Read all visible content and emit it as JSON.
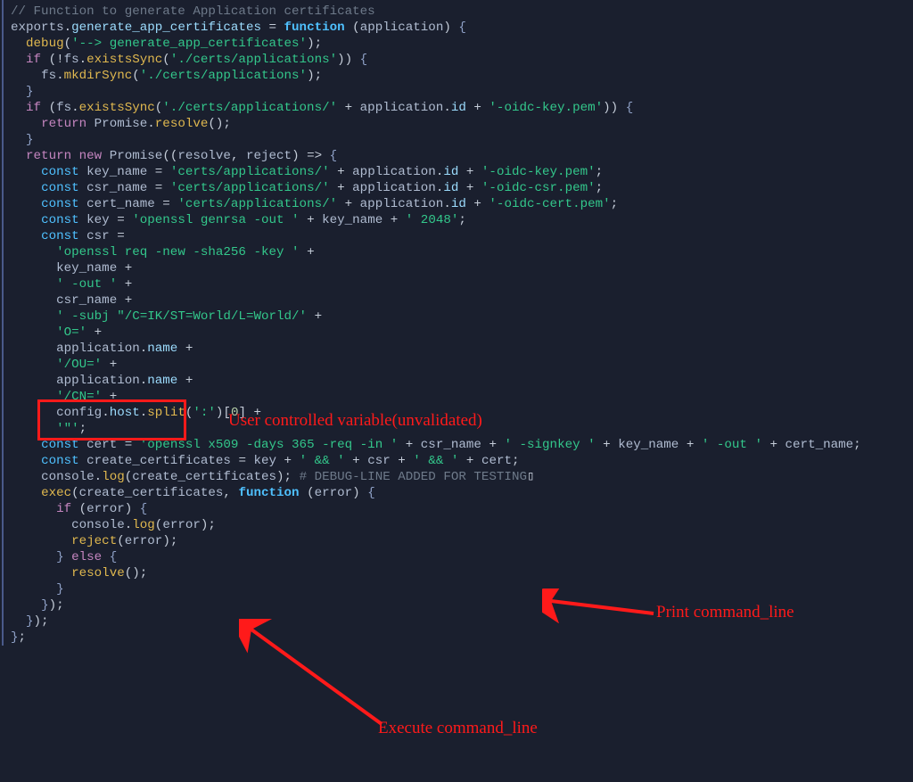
{
  "code_lines_html": [
    "<span class='c-comment'>// Function to generate Application certificates</span>",
    "<span class='c-ident'>exports</span><span class='c-punc'>.</span><span class='c-prop'>generate_app_certificates</span> <span class='c-op'>=</span> <span class='c-func'>function</span> <span class='c-punc'>(</span><span class='c-ident'>application</span><span class='c-punc'>)</span> <span class='c-brace'>{</span>",
    "  <span class='c-call'>debug</span><span class='c-punc'>(</span><span class='c-string'>'--&gt; generate_app_certificates'</span><span class='c-punc'>);</span>",
    "",
    "  <span class='c-keyword2'>if</span> <span class='c-punc'>(</span><span class='c-op'>!</span><span class='c-ident'>fs</span><span class='c-punc'>.</span><span class='c-call'>existsSync</span><span class='c-punc'>(</span><span class='c-string'>'./certs/applications'</span><span class='c-punc'>))</span> <span class='c-brace'>{</span>",
    "    <span class='c-ident'>fs</span><span class='c-punc'>.</span><span class='c-call'>mkdirSync</span><span class='c-punc'>(</span><span class='c-string'>'./certs/applications'</span><span class='c-punc'>);</span>",
    "  <span class='c-brace'>}</span>",
    "",
    "  <span class='c-keyword2'>if</span> <span class='c-punc'>(</span><span class='c-ident'>fs</span><span class='c-punc'>.</span><span class='c-call'>existsSync</span><span class='c-punc'>(</span><span class='c-string'>'./certs/applications/'</span> <span class='c-op'>+</span> <span class='c-ident'>application</span><span class='c-punc'>.</span><span class='c-prop'>id</span> <span class='c-op'>+</span> <span class='c-string'>'-oidc-key.pem'</span><span class='c-punc'>))</span> <span class='c-brace'>{</span>",
    "    <span class='c-keyword2'>return</span> <span class='c-ident'>Promise</span><span class='c-punc'>.</span><span class='c-call'>resolve</span><span class='c-punc'>();</span>",
    "  <span class='c-brace'>}</span>",
    "",
    "  <span class='c-keyword2'>return</span> <span class='c-keyword2'>new</span> <span class='c-ident'>Promise</span><span class='c-punc'>((</span><span class='c-ident'>resolve</span><span class='c-punc'>,</span> <span class='c-ident'>reject</span><span class='c-punc'>)</span> <span class='c-op'>=&gt;</span> <span class='c-brace'>{</span>",
    "    <span class='c-keyword'>const</span> <span class='c-ident'>key_name</span> <span class='c-op'>=</span> <span class='c-string'>'certs/applications/'</span> <span class='c-op'>+</span> <span class='c-ident'>application</span><span class='c-punc'>.</span><span class='c-prop'>id</span> <span class='c-op'>+</span> <span class='c-string'>'-oidc-key.pem'</span><span class='c-punc'>;</span>",
    "    <span class='c-keyword'>const</span> <span class='c-ident'>csr_name</span> <span class='c-op'>=</span> <span class='c-string'>'certs/applications/'</span> <span class='c-op'>+</span> <span class='c-ident'>application</span><span class='c-punc'>.</span><span class='c-prop'>id</span> <span class='c-op'>+</span> <span class='c-string'>'-oidc-csr.pem'</span><span class='c-punc'>;</span>",
    "    <span class='c-keyword'>const</span> <span class='c-ident'>cert_name</span> <span class='c-op'>=</span> <span class='c-string'>'certs/applications/'</span> <span class='c-op'>+</span> <span class='c-ident'>application</span><span class='c-punc'>.</span><span class='c-prop'>id</span> <span class='c-op'>+</span> <span class='c-string'>'-oidc-cert.pem'</span><span class='c-punc'>;</span>",
    "",
    "    <span class='c-keyword'>const</span> <span class='c-ident'>key</span> <span class='c-op'>=</span> <span class='c-string'>'openssl genrsa -out '</span> <span class='c-op'>+</span> <span class='c-ident'>key_name</span> <span class='c-op'>+</span> <span class='c-string'>' 2048'</span><span class='c-punc'>;</span>",
    "    <span class='c-keyword'>const</span> <span class='c-ident'>csr</span> <span class='c-op'>=</span>",
    "      <span class='c-string'>'openssl req -new -sha256 -key '</span> <span class='c-op'>+</span>",
    "      <span class='c-ident'>key_name</span> <span class='c-op'>+</span>",
    "      <span class='c-string'>' -out '</span> <span class='c-op'>+</span>",
    "      <span class='c-ident'>csr_name</span> <span class='c-op'>+</span>",
    "      <span class='c-string'>' -subj \"/C=IK/ST=World/L=World/'</span> <span class='c-op'>+</span>",
    "      <span class='c-string'>'O='</span> <span class='c-op'>+</span>",
    "      <span class='c-ident'>application</span><span class='c-punc'>.</span><span class='c-prop'>name</span> <span class='c-op'>+</span>",
    "      <span class='c-string'>'/OU='</span> <span class='c-op'>+</span>",
    "      <span class='c-ident'>application</span><span class='c-punc'>.</span><span class='c-prop'>name</span> <span class='c-op'>+</span>",
    "      <span class='c-string'>'/CN='</span> <span class='c-op'>+</span>",
    "      <span class='c-ident'>config</span><span class='c-punc'>.</span><span class='c-prop'>host</span><span class='c-punc'>.</span><span class='c-call'>split</span><span class='c-punc'>(</span><span class='c-string'>':'</span><span class='c-punc'>)[</span><span class='c-num'>0</span><span class='c-punc'>]</span> <span class='c-op'>+</span>",
    "      <span class='c-string'>'\"'</span><span class='c-punc'>;</span>",
    "",
    "",
    "    <span class='c-keyword'>const</span> <span class='c-ident'>cert</span> <span class='c-op'>=</span> <span class='c-string'>'openssl x509 -days 365 -req -in '</span> <span class='c-op'>+</span> <span class='c-ident'>csr_name</span> <span class='c-op'>+</span> <span class='c-string'>' -signkey '</span> <span class='c-op'>+</span> <span class='c-ident'>key_name</span> <span class='c-op'>+</span> <span class='c-string'>' -out '</span> <span class='c-op'>+</span> <span class='c-ident'>cert_name</span><span class='c-punc'>;</span>",
    "",
    "    <span class='c-keyword'>const</span> <span class='c-ident'>create_certificates</span> <span class='c-op'>=</span> <span class='c-ident'>key</span> <span class='c-op'>+</span> <span class='c-string'>' &amp;&amp; '</span> <span class='c-op'>+</span> <span class='c-ident'>csr</span> <span class='c-op'>+</span> <span class='c-string'>' &amp;&amp; '</span> <span class='c-op'>+</span> <span class='c-ident'>cert</span><span class='c-punc'>;</span>",
    "    <span class='c-ident'>console</span><span class='c-punc'>.</span><span class='c-call'>log</span><span class='c-punc'>(</span><span class='c-ident'>create_certificates</span><span class='c-punc'>);</span> <span class='c-comment'># DEBUG-LINE ADDED FOR TESTING</span><span class='c-punc'>▯</span>",
    "    <span class='c-call'>exec</span><span class='c-punc'>(</span><span class='c-ident'>create_certificates</span><span class='c-punc'>,</span> <span class='c-func'>function</span> <span class='c-punc'>(</span><span class='c-ident'>error</span><span class='c-punc'>)</span> <span class='c-brace'>{</span>",
    "      <span class='c-keyword2'>if</span> <span class='c-punc'>(</span><span class='c-ident'>error</span><span class='c-punc'>)</span> <span class='c-brace'>{</span>",
    "        <span class='c-ident'>console</span><span class='c-punc'>.</span><span class='c-call'>log</span><span class='c-punc'>(</span><span class='c-ident'>error</span><span class='c-punc'>);</span>",
    "        <span class='c-call'>reject</span><span class='c-punc'>(</span><span class='c-ident'>error</span><span class='c-punc'>);</span>",
    "      <span class='c-brace'>}</span> <span class='c-keyword2'>else</span> <span class='c-brace'>{</span>",
    "        <span class='c-call'>resolve</span><span class='c-punc'>();</span>",
    "      <span class='c-brace'>}</span>",
    "    <span class='c-brace'>}</span><span class='c-punc'>);</span>",
    "  <span class='c-brace'>}</span><span class='c-punc'>);</span>",
    "<span class='c-brace'>}</span><span class='c-punc'>;</span>"
  ],
  "annotations": {
    "user_controlled": "User controlled variable(unvalidated)",
    "print_cmd": "Print command_line",
    "exec_cmd": "Execute command_line"
  }
}
